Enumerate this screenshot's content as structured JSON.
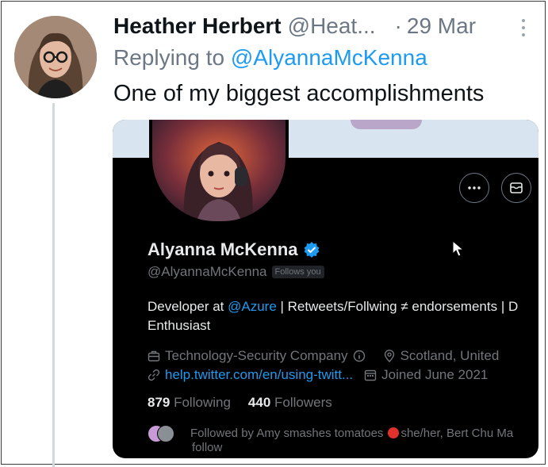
{
  "tweet": {
    "author_name": "Heather Herbert",
    "author_handle": "@Heat...",
    "separator": "·",
    "date": "29 Mar",
    "replying_prefix": "Replying to ",
    "replying_to": "@AlyannaMcKenna",
    "text": "One of my biggest accomplishments"
  },
  "card": {
    "name": "Alyanna McKenna",
    "handle": "@AlyannaMcKenna",
    "follows_you": "Follows you",
    "bio_prefix": "Developer at ",
    "bio_mention": "@Azure",
    "bio_suffix": " | Retweets/Follwing ≠ endorsements | D",
    "bio_line2": "Enthusiast",
    "category": "Technology-Security Company",
    "location": "Scotland, United",
    "link": "help.twitter.com/en/using-twitt...",
    "joined": "Joined June 2021",
    "following_count": "879",
    "following_label": " Following",
    "followers_count": "440",
    "followers_label": " Followers",
    "followed_by": "Followed by Amy smashes tomatoes",
    "followed_by_rest": "she/her, Bert Chu Ma",
    "followed_by_line2": "follow"
  },
  "colors": {
    "link_blue": "#1d9bf0",
    "muted": "#6b7785",
    "card_bg": "#000000"
  },
  "icons": [
    "more-vertical-icon",
    "more-horizontal-icon",
    "mail-icon",
    "verified-badge-icon",
    "briefcase-icon",
    "info-icon",
    "location-pin-icon",
    "link-icon",
    "calendar-icon",
    "mouse-cursor-icon"
  ]
}
